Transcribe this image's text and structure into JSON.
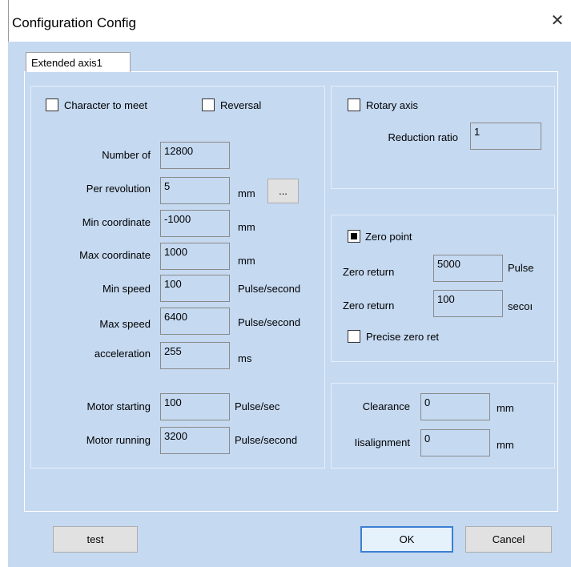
{
  "window": {
    "title": "Configuration Config",
    "close_glyph": "✕"
  },
  "tabs": [
    {
      "label": "Extended axis1"
    }
  ],
  "left_group": {
    "character_to_meet": {
      "label": "Character to meet",
      "checked": false
    },
    "reversal": {
      "label": "Reversal",
      "checked": false
    },
    "fields": [
      {
        "label": "Number of",
        "value": "12800",
        "unit": ""
      },
      {
        "label": "Per revolution",
        "value": "5",
        "unit": "mm"
      },
      {
        "label": "Min coordinate",
        "value": "-1000",
        "unit": "mm"
      },
      {
        "label": "Max coordinate",
        "value": "1000",
        "unit": "mm"
      },
      {
        "label": "Min speed",
        "value": "100",
        "unit": "Pulse/second"
      },
      {
        "label": "Max speed",
        "value": "6400",
        "unit": "Pulse/second"
      },
      {
        "label": "acceleration",
        "value": "255",
        "unit": "ms"
      },
      {
        "label": "Motor starting",
        "value": "100",
        "unit": "Pulse/sec"
      },
      {
        "label": "Motor running",
        "value": "3200",
        "unit": "Pulse/second"
      }
    ],
    "browse_label": "..."
  },
  "rotary_group": {
    "rotary_axis": {
      "label": "Rotary axis",
      "checked": false
    },
    "reduction_ratio": {
      "label": "Reduction ratio",
      "value": "1"
    }
  },
  "zero_group": {
    "zero_point": {
      "label": "Zero point",
      "checked": true
    },
    "zero_return_speed": {
      "label": "Zero return",
      "value": "5000",
      "unit": "Pulse"
    },
    "zero_return_time": {
      "label": "Zero return",
      "value": "100",
      "unit": "secoı"
    },
    "precise_zero": {
      "label": "Precise zero ret",
      "checked": false
    }
  },
  "clearance_group": {
    "clearance": {
      "label": "Clearance",
      "value": "0",
      "unit": "mm"
    },
    "misalignment": {
      "label": "Iisalignment",
      "value": "0",
      "unit": "mm"
    }
  },
  "buttons": {
    "test": "test",
    "ok": "OK",
    "cancel": "Cancel"
  }
}
